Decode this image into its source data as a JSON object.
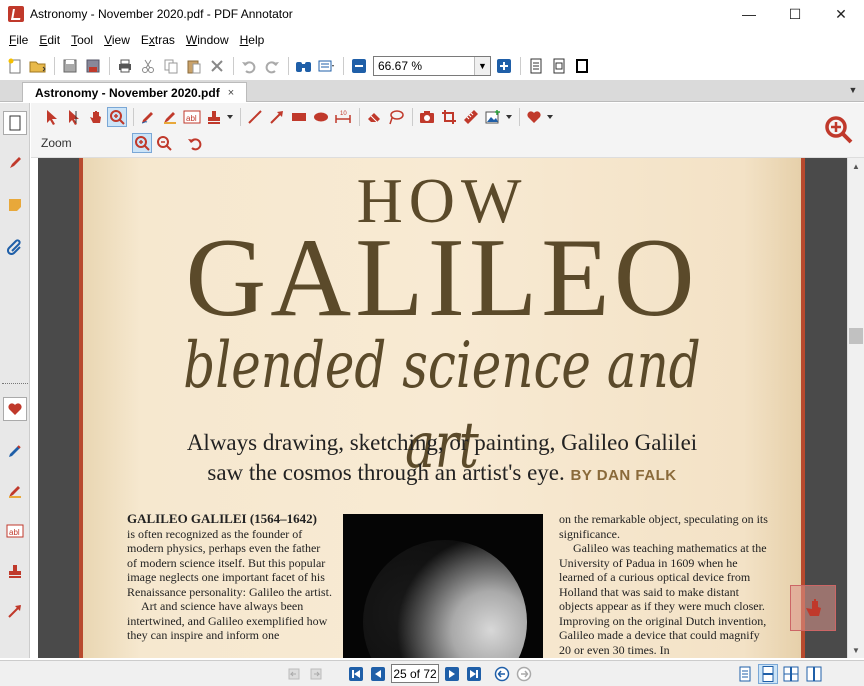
{
  "window": {
    "title": "Astronomy - November 2020.pdf - PDF Annotator",
    "minimize": "—",
    "maximize": "☐",
    "close": "✕"
  },
  "menu": {
    "items": [
      {
        "label": "File",
        "key": "F",
        "rest": "ile"
      },
      {
        "label": "Edit",
        "key": "E",
        "rest": "dit"
      },
      {
        "label": "Tool",
        "key": "T",
        "rest": "ool"
      },
      {
        "label": "View",
        "key": "V",
        "rest": "iew"
      },
      {
        "label": "Extras",
        "key": "x",
        "rest": "tras",
        "prefix": "E"
      },
      {
        "label": "Window",
        "key": "W",
        "rest": "indow"
      },
      {
        "label": "Help",
        "key": "H",
        "rest": "elp"
      }
    ]
  },
  "toolbar": {
    "zoom_value": "66.67 %",
    "icons": [
      "new-icon",
      "open-icon",
      "save-icon",
      "save-as-icon",
      "print-icon",
      "cut-icon",
      "copy-icon",
      "paste-icon",
      "delete-icon",
      "undo-icon",
      "redo-icon",
      "find-icon",
      "properties-icon",
      "zoom-out-icon",
      "zoom-in-icon",
      "single-page-icon",
      "fit-page-icon",
      "fullscreen-icon"
    ]
  },
  "tabs": {
    "active": "Astronomy - November 2020.pdf",
    "close": "×"
  },
  "tools": {
    "zoom_label": "Zoom",
    "accent": "#c0392b"
  },
  "document": {
    "headline_how": "HOW",
    "headline_galileo": "GALILEO",
    "headline_sub": "blended science and art",
    "deck_line1": "Always drawing, sketching, or painting, Galileo Galilei",
    "deck_line2": "saw the cosmos through an artist's eye.",
    "byline": "BY DAN FALK",
    "col1_head": "GALILEO GALILEI (1564–1642)",
    "col1_p1": "is often recognized as the founder of modern physics, perhaps even the father of modern science itself. But this popular image neglects one important facet of his Renaissance personality: Galileo the artist.",
    "col1_p2": "Art and science have always been intertwined, and Galileo exemplified how they can inspire and inform one",
    "col3_p1": "on the remarkable object, speculating on its significance.",
    "col3_p2": "Galileo was teaching mathematics at the University of Padua in 1609 when he learned of a curious optical device from Holland that was said to make distant objects appear as if they were much closer. Improving on the original Dutch invention, Galileo made a device that could magnify 20 or even 30 times. In"
  },
  "status": {
    "page_field": "25 of 72"
  }
}
